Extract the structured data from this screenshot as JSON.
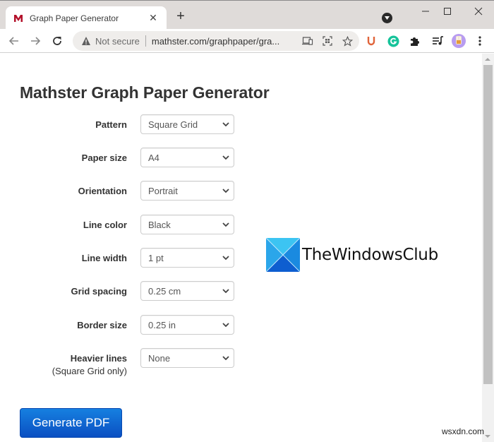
{
  "browser": {
    "tab": {
      "title": "Graph Paper Generator",
      "favicon": "mathster-m-icon"
    },
    "new_tab_label": "+",
    "omnibox": {
      "security_label": "Not secure",
      "url": "mathster.com/graphpaper/gra..."
    },
    "extensions": [
      "u-extension-icon",
      "grammarly-icon",
      "puzzle-extensions-icon",
      "media-queue-icon",
      "profile-avatar",
      "kebab-menu-icon"
    ]
  },
  "page": {
    "title": "Mathster Graph Paper Generator",
    "fields": [
      {
        "label": "Pattern",
        "value": "Square Grid"
      },
      {
        "label": "Paper size",
        "value": "A4"
      },
      {
        "label": "Orientation",
        "value": "Portrait"
      },
      {
        "label": "Line color",
        "value": "Black"
      },
      {
        "label": "Line width",
        "value": "1 pt"
      },
      {
        "label": "Grid spacing",
        "value": "0.25 cm"
      },
      {
        "label": "Border size",
        "value": "0.25 in"
      },
      {
        "label": "Heavier lines",
        "sublabel": "(Square Grid only)",
        "value": "None"
      }
    ],
    "generate_button": "Generate PDF"
  },
  "overlay": {
    "logo_text": "TheWindowsClub",
    "watermark": "wsxdn.com"
  },
  "colors": {
    "button_top": "#1680e0",
    "button_bottom": "#0a4fc2",
    "favicon_red": "#b3102a"
  }
}
